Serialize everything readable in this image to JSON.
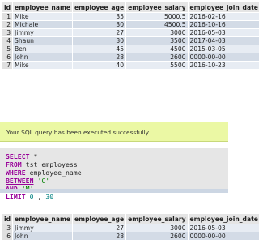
{
  "table_top": {
    "headers": [
      "id",
      "employee_name",
      "employee_age",
      "employee_salary",
      "employee_join_date"
    ],
    "rows": [
      [
        "1",
        "Mike",
        "35",
        "5000.5",
        "2016-02-16"
      ],
      [
        "2",
        "Michale",
        "30",
        "4500.5",
        "2016-10-16"
      ],
      [
        "3",
        "Jimmy",
        "27",
        "3000",
        "2016-05-03"
      ],
      [
        "4",
        "Shaun",
        "30",
        "3500",
        "2017-04-03"
      ],
      [
        "5",
        "Ben",
        "45",
        "4500",
        "2015-03-05"
      ],
      [
        "6",
        "John",
        "28",
        "2600",
        "0000-00-00"
      ],
      [
        "7",
        "Mike",
        "40",
        "5500",
        "2016-10-23"
      ]
    ]
  },
  "status": {
    "message": "Your SQL query has been executed successfully"
  },
  "query": {
    "select_kw": "SELECT",
    "select_rest": " *",
    "from_kw": "FROM",
    "from_rest": " tst_employess",
    "where_kw": "WHERE",
    "where_rest": " employee_name",
    "between_kw": "BETWEEN",
    "between_val": "'C'",
    "and_kw": "AND",
    "and_val": "'M'",
    "limit_kw": "LIMIT",
    "limit_offset": "0",
    "limit_sep": " , ",
    "limit_count": "30"
  },
  "table_bottom": {
    "headers": [
      "id",
      "employee_name",
      "employee_age",
      "employee_salary",
      "employee_join_date"
    ],
    "rows": [
      [
        "3",
        "Jimmy",
        "27",
        "3000",
        "2016-05-03"
      ],
      [
        "6",
        "John",
        "28",
        "2600",
        "0000-00-00"
      ]
    ]
  }
}
